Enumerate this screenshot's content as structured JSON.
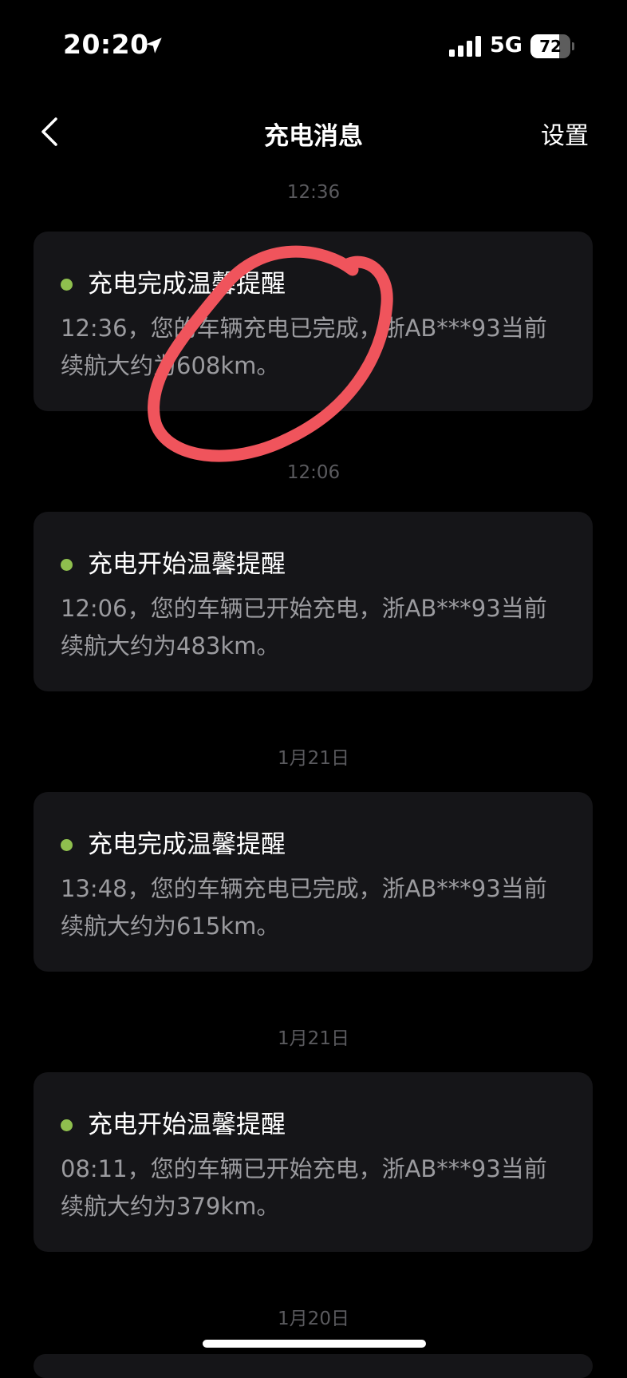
{
  "status_bar": {
    "time": "20:20",
    "network": "5G",
    "battery_level": "72",
    "battery_fraction": 0.72
  },
  "nav": {
    "title": "充电消息",
    "settings_label": "设置"
  },
  "messages": [
    {
      "time_label": "12:36",
      "title": "充电完成温馨提醒",
      "body": "12:36，您的车辆充电已完成，浙AB***93当前续航大约为608km。"
    },
    {
      "time_label": "12:06",
      "title": "充电开始温馨提醒",
      "body": "12:06，您的车辆已开始充电，浙AB***93当前续航大约为483km。"
    },
    {
      "time_label": "1月21日",
      "title": "充电完成温馨提醒",
      "body": "13:48，您的车辆充电已完成，浙AB***93当前续航大约为615km。"
    },
    {
      "time_label": "1月21日",
      "title": "充电开始温馨提醒",
      "body": "08:11，您的车辆已开始充电，浙AB***93当前续航大约为379km。"
    },
    {
      "time_label": "1月20日"
    }
  ],
  "colors": {
    "background": "#000000",
    "card": "#151518",
    "status_dot": "#8fbf4e",
    "annotation": "#f0545c",
    "muted_text": "#9b9b9f"
  },
  "icons": {
    "location": "location-arrow-icon",
    "signal": "cellular-signal-icon",
    "battery": "battery-icon",
    "back": "chevron-left-icon"
  }
}
